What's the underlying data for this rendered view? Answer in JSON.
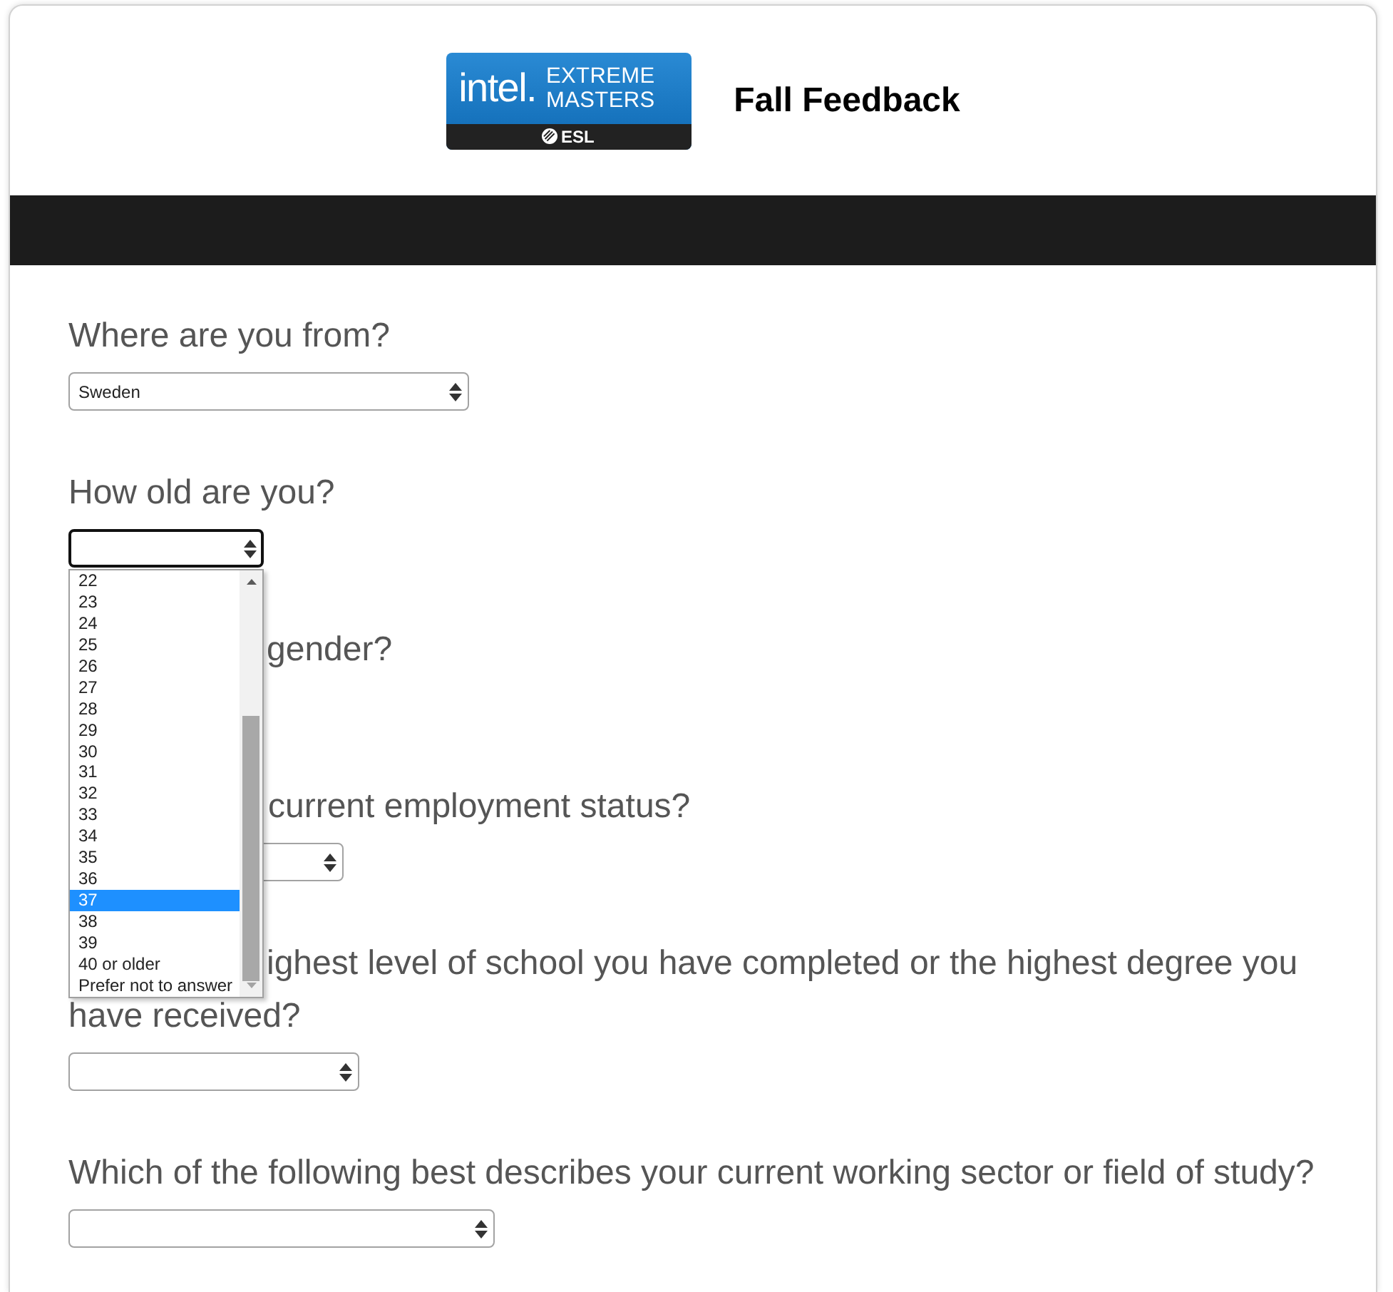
{
  "header": {
    "logo": {
      "wordmark": "intel.",
      "name": "EXTREME MASTERS",
      "strip_text": "ESL"
    },
    "title": "Fall Feedback"
  },
  "questions": [
    {
      "label_lines": [
        "Where are you from?"
      ],
      "select": {
        "value": "Sweden",
        "focused": false
      }
    },
    {
      "label_lines": [
        "How old are you?"
      ],
      "select": {
        "focused": true,
        "open": true,
        "options": [
          {
            "label": "22",
            "selected": false
          },
          {
            "label": "23",
            "selected": false
          },
          {
            "label": "24",
            "selected": false
          },
          {
            "label": "25",
            "selected": false
          },
          {
            "label": "26",
            "selected": false
          },
          {
            "label": "27",
            "selected": false
          },
          {
            "label": "28",
            "selected": false
          },
          {
            "label": "29",
            "selected": false
          },
          {
            "label": "30",
            "selected": false
          },
          {
            "label": "31",
            "selected": false
          },
          {
            "label": "32",
            "selected": false
          },
          {
            "label": "33",
            "selected": false
          },
          {
            "label": "34",
            "selected": false
          },
          {
            "label": "35",
            "selected": false
          },
          {
            "label": "36",
            "selected": false
          },
          {
            "label": "37",
            "selected": true
          },
          {
            "label": "38",
            "selected": false
          },
          {
            "label": "39",
            "selected": false
          },
          {
            "label": "40 or older",
            "selected": false
          },
          {
            "label": "Prefer not to answer",
            "selected": false
          }
        ]
      }
    },
    {
      "label_lines": [
        "gender?"
      ]
    },
    {
      "label_lines": [
        "current employment status?"
      ],
      "select": {
        "focused": false
      }
    },
    {
      "label_lines": [
        "ighest level of school you have completed or the highest degree you",
        "have received?"
      ],
      "select": {
        "focused": false
      }
    },
    {
      "label_lines": [
        "Which of the following best describes your current working sector or field of study?"
      ],
      "select": {
        "focused": false
      }
    }
  ]
}
